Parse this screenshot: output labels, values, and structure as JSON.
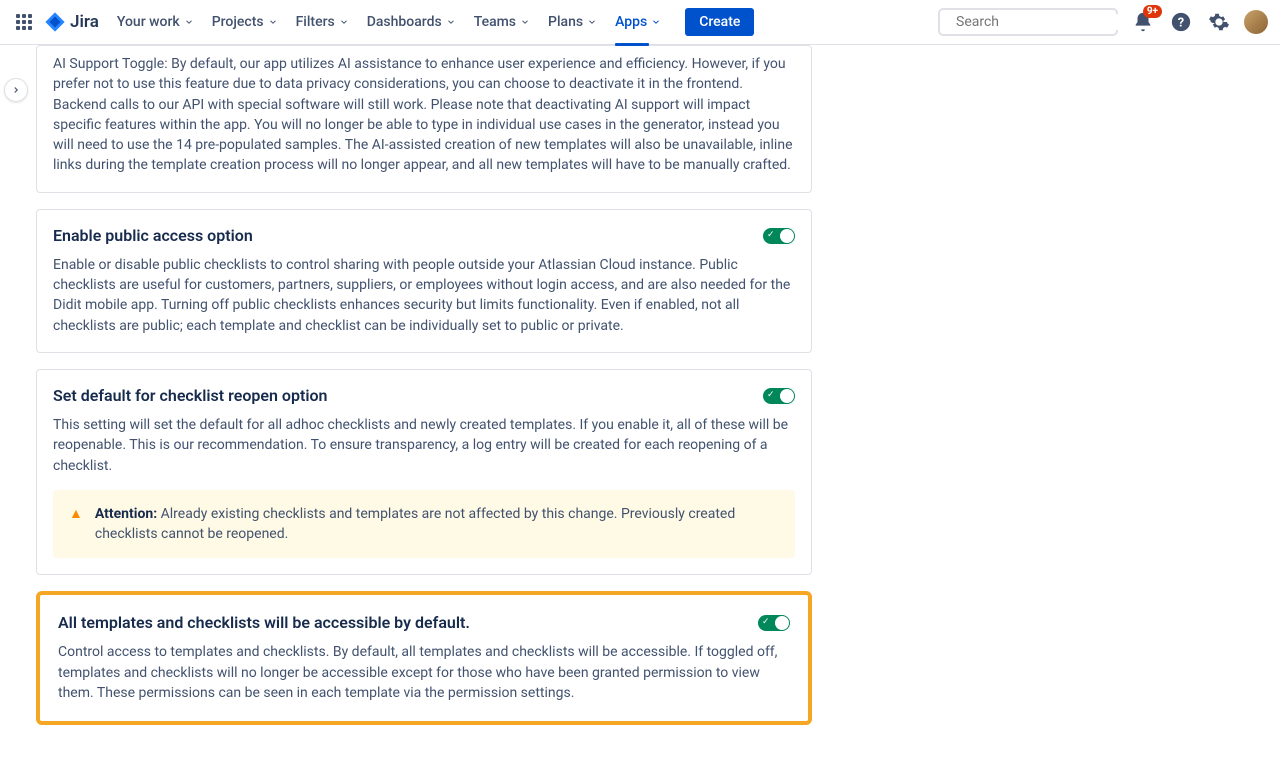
{
  "nav": {
    "product": "Jira",
    "items": [
      "Your work",
      "Projects",
      "Filters",
      "Dashboards",
      "Teams",
      "Plans",
      "Apps"
    ],
    "active_index": 6,
    "create": "Create",
    "search_placeholder": "Search",
    "notif_badge": "9+"
  },
  "cards": [
    {
      "partial": true,
      "body": "AI Support Toggle: By default, our app utilizes AI assistance to enhance user experience and efficiency. However, if you prefer not to use this feature due to data privacy considerations, you can choose to deactivate it in the frontend. Backend calls to our API with special software will still work. Please note that deactivating AI support will impact specific features within the app. You will no longer be able to type in individual use cases in the generator, instead you will need to use the 14 pre-populated samples. The AI-assisted creation of new templates will also be unavailable, inline links during the template creation process will no longer appear, and all new templates will have to be manually crafted."
    },
    {
      "title": "Enable public access option",
      "toggled": true,
      "body": "Enable or disable public checklists to control sharing with people outside your Atlassian Cloud instance. Public checklists are useful for customers, partners, suppliers, or employees without login access, and are also needed for the Didit mobile app. Turning off public checklists enhances security but limits functionality. Even if enabled, not all checklists are public; each template and checklist can be individually set to public or private."
    },
    {
      "title": "Set default for checklist reopen option",
      "toggled": true,
      "body": "This setting will set the default for all adhoc checklists and newly created templates. If you enable it, all of these will be reopenable. This is our recommendation. To ensure transparency, a log entry will be created for each reopening of a checklist.",
      "alert": {
        "label": "Attention:",
        "text": " Already existing checklists and templates are not affected by this change. Previously created checklists cannot be reopened."
      }
    },
    {
      "title": "All templates and checklists will be accessible by default.",
      "toggled": true,
      "highlighted": true,
      "body": "Control access to templates and checklists. By default, all templates and checklists will be accessible. If toggled off, templates and checklists will no longer be accessible except for those who have been granted permission to view them. These permissions can be seen in each template via the permission settings."
    }
  ]
}
